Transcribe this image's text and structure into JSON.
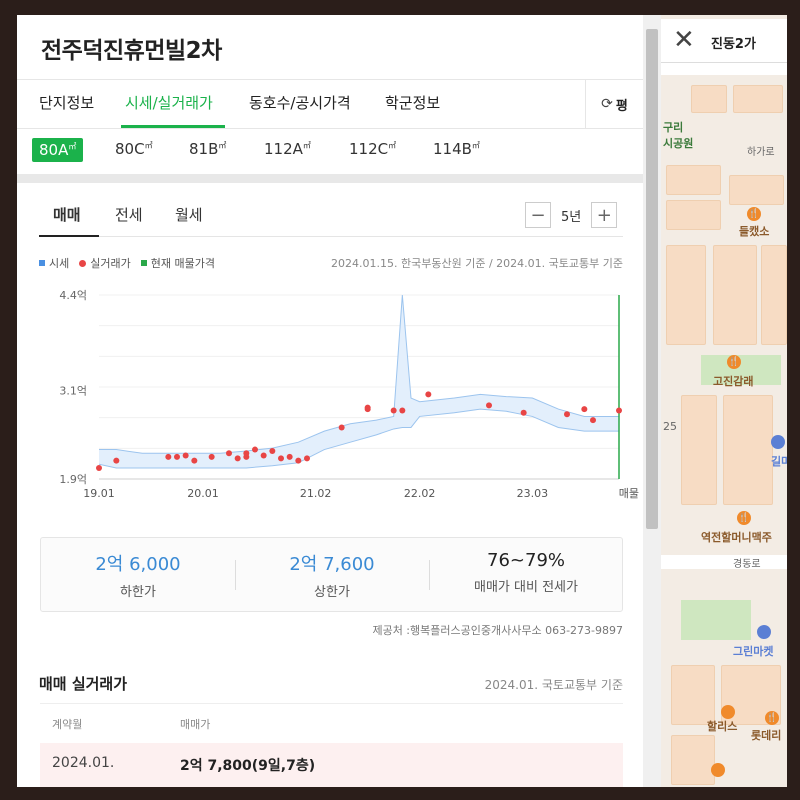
{
  "complex": {
    "title": "전주덕진휴먼빌2차"
  },
  "tabs": [
    {
      "label": "단지정보"
    },
    {
      "label": "시세/실거래가",
      "active": true
    },
    {
      "label": "동호수/공시가격"
    },
    {
      "label": "학군정보"
    }
  ],
  "refresh": {
    "icon": "refresh-icon",
    "label": "평"
  },
  "sizes": [
    {
      "label": "80A",
      "unit": "㎡",
      "active": true
    },
    {
      "label": "80C",
      "unit": "㎡"
    },
    {
      "label": "81B",
      "unit": "㎡"
    },
    {
      "label": "112A",
      "unit": "㎡"
    },
    {
      "label": "112C",
      "unit": "㎡"
    },
    {
      "label": "114B",
      "unit": "㎡"
    }
  ],
  "trade_tabs": [
    {
      "label": "매매",
      "active": true
    },
    {
      "label": "전세"
    },
    {
      "label": "월세"
    }
  ],
  "period": {
    "minus": "−",
    "value": "5년",
    "plus": "+"
  },
  "legend": {
    "market": "시세",
    "actual": "실거래가",
    "listing": "현재 매물가격",
    "note": "2024.01.15. 한국부동산원 기준 / 2024.01. 국토교통부 기준",
    "colors": {
      "market": "#4a90e2",
      "actual": "#e84545",
      "listing": "#2aa84a"
    }
  },
  "chart_data": {
    "type": "line",
    "xlabel": "",
    "ylabel": "",
    "x_tick_labels": [
      "19.01",
      "20.01",
      "21.02",
      "22.02",
      "23.03"
    ],
    "x_end_label": "매물없음",
    "y_tick_labels": [
      "4.4억",
      "3.1억",
      "1.9억"
    ],
    "y_ticks": [
      4.4,
      3.1,
      1.9
    ],
    "ylim": [
      1.9,
      4.4
    ],
    "xlim": [
      "2019-01",
      "2024-01"
    ],
    "grid": true,
    "market_band": {
      "x": [
        "2019-01",
        "2019-03",
        "2019-06",
        "2019-09",
        "2019-12",
        "2020-03",
        "2020-06",
        "2020-09",
        "2020-12",
        "2021-03",
        "2021-06",
        "2021-09",
        "2021-11",
        "2021-12",
        "2022-01",
        "2022-02",
        "2022-06",
        "2022-09",
        "2022-12",
        "2023-03",
        "2023-06",
        "2023-09",
        "2023-12",
        "2024-01"
      ],
      "lower": [
        2.1,
        2.05,
        2.05,
        2.05,
        2.05,
        2.05,
        2.05,
        2.08,
        2.12,
        2.3,
        2.4,
        2.5,
        2.58,
        2.6,
        2.6,
        2.75,
        2.8,
        2.85,
        2.82,
        2.75,
        2.6,
        2.55,
        2.55,
        2.55
      ],
      "upper": [
        2.3,
        2.3,
        2.25,
        2.25,
        2.25,
        2.25,
        2.28,
        2.32,
        2.4,
        2.55,
        2.65,
        2.7,
        2.75,
        4.4,
        3.0,
        2.95,
        3.0,
        3.05,
        3.02,
        3.0,
        2.85,
        2.75,
        2.75,
        2.75
      ]
    },
    "actual_trades": [
      {
        "x": "2019-01",
        "y": 2.05
      },
      {
        "x": "2019-03",
        "y": 2.15
      },
      {
        "x": "2019-09",
        "y": 2.2
      },
      {
        "x": "2019-10",
        "y": 2.2
      },
      {
        "x": "2019-11",
        "y": 2.22
      },
      {
        "x": "2019-12",
        "y": 2.15
      },
      {
        "x": "2020-02",
        "y": 2.2
      },
      {
        "x": "2020-04",
        "y": 2.25
      },
      {
        "x": "2020-05",
        "y": 2.18
      },
      {
        "x": "2020-06",
        "y": 2.2
      },
      {
        "x": "2020-06",
        "y": 2.25
      },
      {
        "x": "2020-07",
        "y": 2.3
      },
      {
        "x": "2020-08",
        "y": 2.22
      },
      {
        "x": "2020-09",
        "y": 2.28
      },
      {
        "x": "2020-10",
        "y": 2.18
      },
      {
        "x": "2020-11",
        "y": 2.2
      },
      {
        "x": "2020-12",
        "y": 2.15
      },
      {
        "x": "2021-01",
        "y": 2.18
      },
      {
        "x": "2021-05",
        "y": 2.6
      },
      {
        "x": "2021-08",
        "y": 2.85
      },
      {
        "x": "2021-08",
        "y": 2.87
      },
      {
        "x": "2021-11",
        "y": 2.83
      },
      {
        "x": "2021-12",
        "y": 2.83
      },
      {
        "x": "2022-03",
        "y": 3.05
      },
      {
        "x": "2022-10",
        "y": 2.9
      },
      {
        "x": "2023-02",
        "y": 2.8
      },
      {
        "x": "2023-07",
        "y": 2.78
      },
      {
        "x": "2023-09",
        "y": 2.85
      },
      {
        "x": "2023-10",
        "y": 2.7
      },
      {
        "x": "2024-01",
        "y": 2.83
      }
    ],
    "listing_marker": {
      "x": "2024-01",
      "label": "매물없음"
    }
  },
  "stats": [
    {
      "value": "2억 6,000",
      "label": "하한가"
    },
    {
      "value": "2억 7,600",
      "label": "상한가"
    },
    {
      "value": "76~79%",
      "label": "매매가 대비 전세가"
    }
  ],
  "provider": "제공처 :행복플러스공인중개사사무소 063-273-9897",
  "deals": {
    "title": "매매 실거래가",
    "note": "2024.01. 국토교통부 기준",
    "columns": [
      "계약월",
      "매매가"
    ],
    "rows": [
      {
        "month": "2024.01.",
        "price": "2억 7,800(9일,7층)"
      }
    ]
  },
  "map": {
    "region": "진동2가",
    "close_icon": "close-icon",
    "labels": {
      "park": "구리\n시공원",
      "road1": "하가로",
      "poi1": "들캤소",
      "poi2": "고진감래",
      "bus": "25",
      "poi3": "길마",
      "poi4": "역전할머니맥주",
      "road2": "경동로",
      "poi5": "그린마켓",
      "poi6": "할리스",
      "poi7": "롯데리"
    }
  }
}
